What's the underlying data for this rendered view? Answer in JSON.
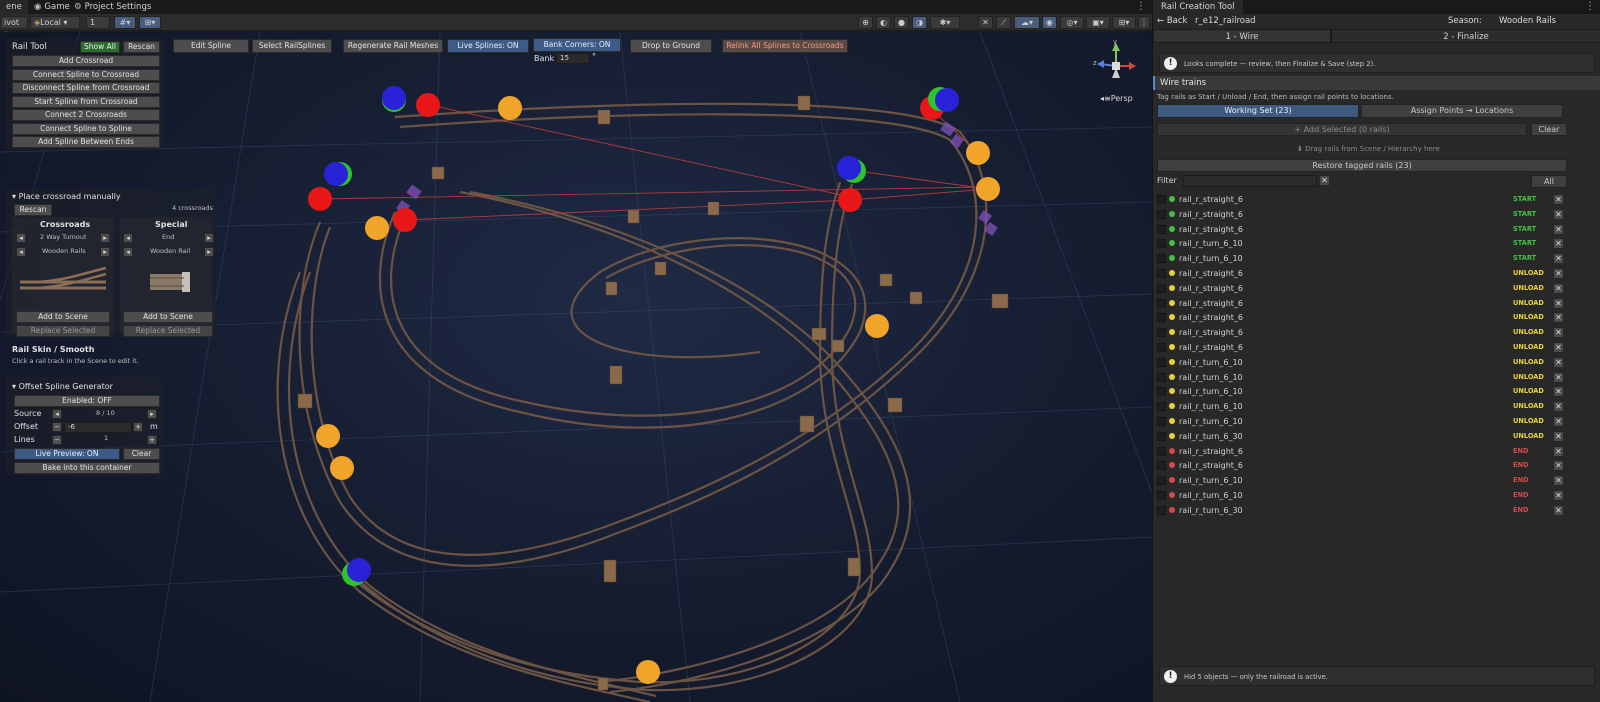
{
  "tabs": {
    "scene": "ene",
    "game": "Game",
    "project_settings": "Project Settings"
  },
  "scene_toolbar": {
    "pivot": "ivot",
    "local": "Local",
    "grid_value": "1"
  },
  "viewport": {
    "top_buttons": [
      "Edit Spline",
      "Select RailSplines",
      "Regenerate Rail Meshes",
      "Live Splines: ON",
      "Bank Corners: ON",
      "Drop to Ground",
      "Relink All Splines to Crossroads"
    ],
    "bank_label": "Bank",
    "bank_value": "15",
    "bank_unit": "°",
    "persp_label": "Persp",
    "gizmo_y": "y",
    "gizmo_z": "z"
  },
  "rail_tool": {
    "title": "Rail Tool",
    "show_all": "Show All",
    "rescan": "Rescan",
    "actions": [
      "Add Crossroad",
      "Connect Spline to Crossroad",
      "Disconnect Spline from Crossroad",
      "Start Spline from Crossroad",
      "Connect 2 Crossroads",
      "Connect Spline to Spline",
      "Add Spline Between Ends"
    ]
  },
  "crossroad_panel": {
    "title": "Place crossroad manually",
    "count": "4 crossroads",
    "rescan": "Rescan",
    "crossroads_title": "Crossroads",
    "crossroads_type": "2 Way Turnout",
    "crossroads_skin": "Wooden Rails",
    "special_title": "Special",
    "special_type": "End",
    "special_skin": "Wooden Rail",
    "add_to_scene": "Add to Scene",
    "replace_selected": "Replace Selected"
  },
  "rail_skin": {
    "title": "Rail Skin / Smooth",
    "hint": "Click a rail track in the Scene to edit it."
  },
  "offset_gen": {
    "title": "Offset Spline Generator",
    "enabled": "Enabled: OFF",
    "source_label": "Source",
    "source_value": "8 / 10",
    "offset_label": "Offset",
    "offset_value": "-6",
    "offset_unit": "m",
    "lines_label": "Lines",
    "lines_value": "1",
    "live_preview": "Live Preview: ON",
    "clear": "Clear",
    "bake": "Bake into this container"
  },
  "right_panel": {
    "tab_title": "Rail Creation Tool",
    "back": "Back",
    "railroad_name": "r_e12_railroad",
    "season_label": "Season:",
    "season_value": "Wooden Rails",
    "step1": "1 - Wire",
    "step2": "2 - Finalize",
    "info": "Looks complete — review, then Finalize & Save (step 2).",
    "section_title": "Wire trains",
    "section_hint": "Tag rails as Start / Unload / End, then assign rail points to locations.",
    "working_set": "Working Set (23)",
    "assign_points": "Assign Points → Locations",
    "add_selected": "+ Add Selected (0 rails)",
    "clear": "Clear",
    "drag_hint": "⬇ Drag rails from Scene / Hierarchy here",
    "restore": "Restore tagged rails (23)",
    "filter_label": "Filter",
    "filter_value": "",
    "all": "All",
    "footer": "Hid 5 objects — only the railroad is active."
  },
  "colors": {
    "start": "#41c441",
    "unload": "#e6d33c",
    "end": "#d24a4a",
    "accent_blue": "#3d5b86"
  },
  "rails": [
    {
      "name": "rail_r_straight_6",
      "tag": "START"
    },
    {
      "name": "rail_r_straight_6",
      "tag": "START"
    },
    {
      "name": "rail_r_straight_6",
      "tag": "START"
    },
    {
      "name": "rail_r_turn_6_10",
      "tag": "START"
    },
    {
      "name": "rail_r_turn_6_10",
      "tag": "START"
    },
    {
      "name": "rail_r_straight_6",
      "tag": "UNLOAD"
    },
    {
      "name": "rail_r_straight_6",
      "tag": "UNLOAD"
    },
    {
      "name": "rail_r_straight_6",
      "tag": "UNLOAD"
    },
    {
      "name": "rail_r_straight_6",
      "tag": "UNLOAD"
    },
    {
      "name": "rail_r_straight_6",
      "tag": "UNLOAD"
    },
    {
      "name": "rail_r_straight_6",
      "tag": "UNLOAD"
    },
    {
      "name": "rail_r_turn_6_10",
      "tag": "UNLOAD"
    },
    {
      "name": "rail_r_turn_6_10",
      "tag": "UNLOAD"
    },
    {
      "name": "rail_r_turn_6_10",
      "tag": "UNLOAD"
    },
    {
      "name": "rail_r_turn_6_10",
      "tag": "UNLOAD"
    },
    {
      "name": "rail_r_turn_6_10",
      "tag": "UNLOAD"
    },
    {
      "name": "rail_r_turn_6_30",
      "tag": "UNLOAD"
    },
    {
      "name": "rail_r_straight_6",
      "tag": "END"
    },
    {
      "name": "rail_r_straight_6",
      "tag": "END"
    },
    {
      "name": "rail_r_turn_6_10",
      "tag": "END"
    },
    {
      "name": "rail_r_turn_6_10",
      "tag": "END"
    },
    {
      "name": "rail_r_turn_6_30",
      "tag": "END"
    }
  ]
}
